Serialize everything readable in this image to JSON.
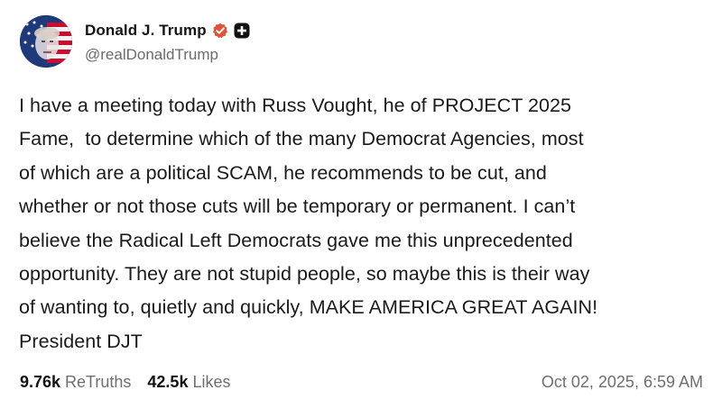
{
  "author": {
    "display_name": "Donald J. Trump",
    "handle": "@realDonaldTrump",
    "avatar_icon": "profile-photo",
    "verified_icon": "verified-badge-icon",
    "badge_icon": "plus-badge-icon",
    "verified_color": "#e25a3c"
  },
  "post": {
    "text": "I have a meeting today with Russ Vought, he of PROJECT 2025\nFame,  to determine which of the many Democrat Agencies, most\nof which are a political SCAM, he recommends to be cut, and\nwhether or not those cuts will be temporary or permanent. I can’t\nbelieve the Radical Left Democrats gave me this unprecedented\nopportunity. They are not stupid people, so maybe this is their way\nof wanting to, quietly and quickly, MAKE AMERICA GREAT AGAIN!\nPresident DJT"
  },
  "footer": {
    "retruths_count": "9.76k",
    "retruths_label": "ReTruths",
    "likes_count": "42.5k",
    "likes_label": "Likes",
    "timestamp": "Oct 02, 2025, 6:59 AM"
  }
}
